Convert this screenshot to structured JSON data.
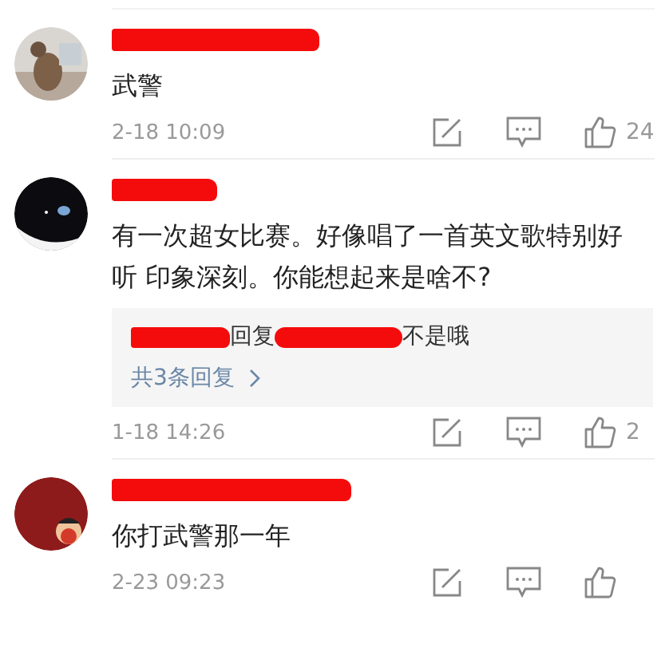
{
  "comments": [
    {
      "author_redacted": true,
      "text": "武警",
      "time": "2-18 10:09",
      "likes": "24"
    },
    {
      "author_redacted": true,
      "text": "有一次超女比赛。好像唱了一首英文歌特别好听 印象深刻。你能想起来是啥不?",
      "time": "1-18 14:26",
      "likes": "2",
      "replies": {
        "preview": {
          "verb": "回复",
          "text": "不是哦"
        },
        "more": "共3条回复"
      }
    },
    {
      "author_redacted": true,
      "text": "你打武警那一年",
      "time": "2-23 09:23"
    }
  ]
}
